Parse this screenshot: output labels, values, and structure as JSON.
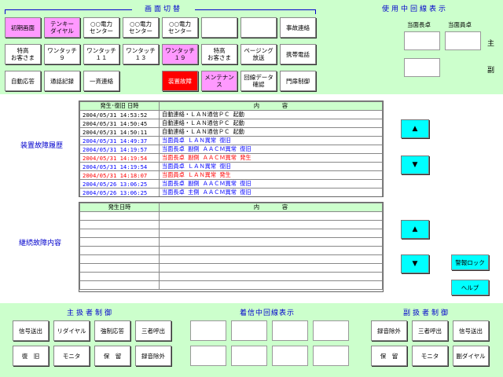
{
  "top": {
    "screen_switch_title": "画面切替",
    "line_display_title": "使用中回線表示",
    "buttons_row1": [
      "初期画面",
      "テンキー\nダイヤル",
      "○○電力\nセンター",
      "○○電力\nセンター",
      "○○電力\nセンター",
      "",
      "",
      "事故連絡"
    ],
    "buttons_row2": [
      "特高\nお客さま",
      "ワンタッチ\n９",
      "ワンタッチ\n１１",
      "ワンタッチ\n１３",
      "ワンタッチ\n１９",
      "特高\nお客さま",
      "ページング\n放送",
      "携帯電話"
    ],
    "buttons_row3": [
      "自動応答",
      "通話記録",
      "一斉連絡",
      "",
      "装置故障",
      "メンテナン\nス",
      "回線データ\n確認",
      "門扉制御"
    ],
    "line_labels": {
      "left_desk": "当面長卓",
      "right_desk": "当面員卓",
      "main": "主",
      "sub": "副"
    }
  },
  "middle": {
    "history_label": "装置故障履歴",
    "continuing_label": "継続故障内容",
    "history_headers": [
      "発生･復旧 日時",
      "内　　　　容"
    ],
    "history_rows": [
      {
        "time": "2004/05/31 14:53:52",
        "content": "自動連絡・ＬＡＮ通信ＰＣ 起動",
        "color": "#000000"
      },
      {
        "time": "2004/05/31 14:50:45",
        "content": "自動連絡・ＬＡＮ通信ＰＣ 起動",
        "color": "#000000"
      },
      {
        "time": "2004/05/31 14:50:11",
        "content": "自動連絡・ＬＡＮ通信ＰＣ 起動",
        "color": "#000000"
      },
      {
        "time": "2004/05/31 14:49:37",
        "content": "当面員卓 ＬＡＮ異常 復旧",
        "color": "#0000ff"
      },
      {
        "time": "2004/05/31 14:19:57",
        "content": "当面長卓 副側 ＡＡＣＭ異常 復旧",
        "color": "#0000ff"
      },
      {
        "time": "2004/05/31 14:19:54",
        "content": "当面長卓 副側 ＡＡＣＭ異常 発生",
        "color": "#ff0000"
      },
      {
        "time": "2004/05/31 14:19:54",
        "content": "当面員卓 ＬＡＮ異常 復旧",
        "color": "#0000ff"
      },
      {
        "time": "2004/05/31 14:18:07",
        "content": "当面員卓 ＬＡＮ異常 発生",
        "color": "#ff0000"
      },
      {
        "time": "2004/05/26 13:06:25",
        "content": "当面長卓 副側 ＡＡＣＭ異常 復旧",
        "color": "#0000ff"
      },
      {
        "time": "2004/05/26 13:06:25",
        "content": "当面長卓 主側 ＡＡＣＭ異常 復旧",
        "color": "#0000ff"
      }
    ],
    "continuing_headers": [
      "発生日時",
      "内　　　　容"
    ],
    "alarm_lock": "警報ロック",
    "help": "ヘルプ",
    "up_arrow": "▲",
    "down_arrow": "▼"
  },
  "bottom": {
    "main_title": "主扱者制御",
    "incoming_title": "着信中回線表示",
    "sub_title": "副扱者制御",
    "main_row1": [
      "信号送出",
      "リダイヤル",
      "強制応答",
      "三者呼出"
    ],
    "main_row2": [
      "復　旧",
      "モニタ",
      "保　留",
      "録音除外"
    ],
    "sub_row1": [
      "録音除外",
      "三者呼出",
      "信号送出"
    ],
    "sub_row2": [
      "保　留",
      "モニタ",
      "副ダイヤル"
    ]
  },
  "colors": {
    "panel": "#ccffcc",
    "pink": "#ff99ff",
    "red": "#ff0000",
    "cyan": "#00ffff",
    "blue_text": "#0000cc"
  }
}
